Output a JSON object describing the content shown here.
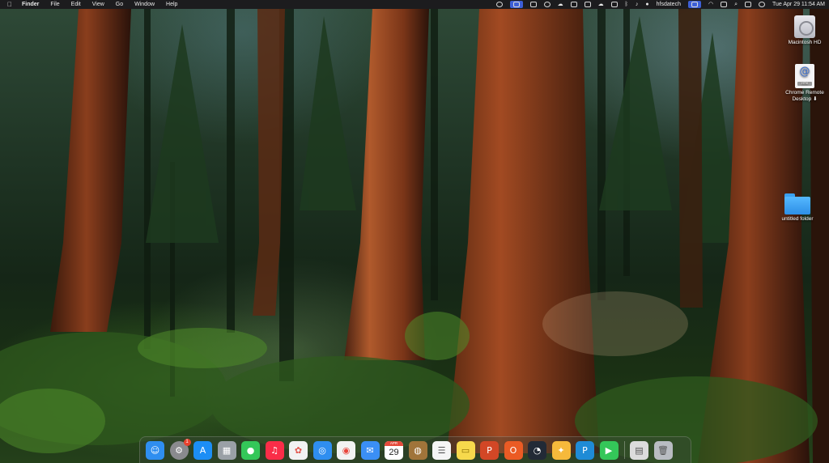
{
  "menubar": {
    "apple_icon": "apple-logo-icon",
    "app_name": "Finder",
    "menus": [
      "File",
      "Edit",
      "View",
      "Go",
      "Window",
      "Help"
    ],
    "user_label": "hfsdatech",
    "datetime": "Tue Apr 29  11:54 AM"
  },
  "desktop_icons": [
    {
      "label": "Macintosh HD",
      "icon": "hard-drive-icon"
    },
    {
      "label": "Chrome Remote Desktop ⬇",
      "icon": "webloc-document-icon",
      "glyph": "@",
      "tag": "HTM"
    },
    {
      "label": "untitled folder",
      "icon": "folder-icon"
    }
  ],
  "dock": {
    "apps": [
      {
        "name": "Finder",
        "icon": "finder-icon",
        "color": "#2f8ef0"
      },
      {
        "name": "System Settings",
        "icon": "system-settings-icon",
        "color": "#8a8a8e",
        "badge": "1"
      },
      {
        "name": "App Store",
        "icon": "app-store-icon",
        "color": "#1c8ef5"
      },
      {
        "name": "Launchpad",
        "icon": "launchpad-icon",
        "color": "#9aa0a6"
      },
      {
        "name": "Messages",
        "icon": "messages-icon",
        "color": "#34c759"
      },
      {
        "name": "Music",
        "icon": "music-icon",
        "color": "#fa2d48"
      },
      {
        "name": "Photos",
        "icon": "photos-icon",
        "color": "#f2f2f2"
      },
      {
        "name": "Safari",
        "icon": "safari-icon",
        "color": "#2f8ef0"
      },
      {
        "name": "Chrome",
        "icon": "chrome-icon",
        "color": "#f2f2f2"
      },
      {
        "name": "Mail",
        "icon": "mail-icon",
        "color": "#3b8ff5"
      },
      {
        "name": "Calendar",
        "icon": "calendar-icon",
        "month": "APR",
        "day": "29"
      },
      {
        "name": "Notes Stack",
        "icon": "notebook-icon",
        "color": "#a0743a"
      },
      {
        "name": "Reminders",
        "icon": "reminders-icon",
        "color": "#f5f5f5"
      },
      {
        "name": "Notes",
        "icon": "notes-icon",
        "color": "#f7d94c"
      },
      {
        "name": "PowerPoint",
        "icon": "powerpoint-icon",
        "color": "#d24726"
      },
      {
        "name": "Office",
        "icon": "office-icon",
        "color": "#eb5b24"
      },
      {
        "name": "Activity Monitor",
        "icon": "activity-monitor-icon",
        "color": "#222a36"
      },
      {
        "name": "Tips",
        "icon": "tips-icon",
        "color": "#f6b93b"
      },
      {
        "name": "Parallels",
        "icon": "parallels-icon",
        "color": "#1f8bd6"
      },
      {
        "name": "FaceTime",
        "icon": "facetime-icon",
        "color": "#34c759"
      }
    ],
    "stack": [
      {
        "name": "Downloads",
        "icon": "downloads-stack-icon",
        "color": "#dcdcdc"
      },
      {
        "name": "Trash",
        "icon": "trash-icon",
        "color": "#b9bcc2"
      }
    ]
  }
}
